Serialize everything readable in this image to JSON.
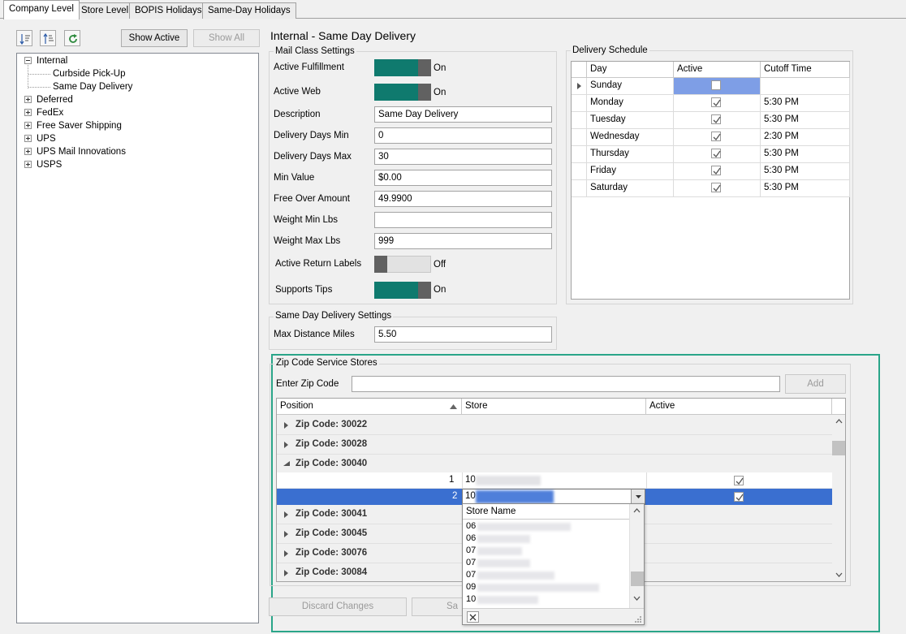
{
  "tabs": [
    "Company Level",
    "Store Level",
    "BOPIS Holidays",
    "Same-Day Holidays"
  ],
  "left_pane": {
    "show_active_label": "Show Active",
    "show_all_label": "Show All",
    "tree": {
      "root": "Internal",
      "children": [
        "Curbside Pick-Up",
        "Same Day Delivery"
      ],
      "siblings": [
        "Deferred",
        "FedEx",
        "Free Saver Shipping",
        "UPS",
        "UPS Mail Innovations",
        "USPS"
      ]
    }
  },
  "detail": {
    "title": "Internal - Same Day Delivery",
    "mail_class": {
      "group_title": "Mail Class Settings",
      "active_fulfillment": {
        "label": "Active Fulfillment",
        "state": "On"
      },
      "active_web": {
        "label": "Active Web",
        "state": "On"
      },
      "description": {
        "label": "Description",
        "value": "Same Day Delivery"
      },
      "delivery_days_min": {
        "label": "Delivery Days Min",
        "value": "0"
      },
      "delivery_days_max": {
        "label": "Delivery Days Max",
        "value": "30"
      },
      "min_value": {
        "label": "Min Value",
        "value": "$0.00"
      },
      "free_over_amount": {
        "label": "Free Over Amount",
        "value": "49.9900"
      },
      "weight_min": {
        "label": "Weight Min Lbs",
        "value": ""
      },
      "weight_max": {
        "label": "Weight Max Lbs",
        "value": "999"
      },
      "active_return_labels": {
        "label": "Active Return Labels",
        "state": "Off"
      },
      "supports_tips": {
        "label": "Supports Tips",
        "state": "On"
      }
    },
    "same_day": {
      "group_title": "Same Day Delivery Settings",
      "max_distance": {
        "label": "Max Distance Miles",
        "value": "5.50"
      }
    },
    "schedule": {
      "group_title": "Delivery Schedule",
      "columns": [
        "Day",
        "Active",
        "Cutoff Time"
      ],
      "rows": [
        {
          "day": "Sunday",
          "active": false,
          "cutoff": ""
        },
        {
          "day": "Monday",
          "active": true,
          "cutoff": "5:30 PM"
        },
        {
          "day": "Tuesday",
          "active": true,
          "cutoff": "5:30 PM"
        },
        {
          "day": "Wednesday",
          "active": true,
          "cutoff": "2:30 PM"
        },
        {
          "day": "Thursday",
          "active": true,
          "cutoff": "5:30 PM"
        },
        {
          "day": "Friday",
          "active": true,
          "cutoff": "5:30 PM"
        },
        {
          "day": "Saturday",
          "active": true,
          "cutoff": "5:30 PM"
        }
      ]
    },
    "zip": {
      "group_title": "Zip Code Service Stores",
      "enter_label": "Enter Zip Code",
      "input_value": "",
      "add_label": "Add",
      "columns": [
        "Position",
        "Store",
        "Active"
      ],
      "groups_before": [
        "Zip Code: 30022",
        "Zip Code: 30028",
        "Zip Code: 30040"
      ],
      "expanded_rows": [
        {
          "position": "1",
          "store": "10",
          "active": true
        },
        {
          "position": "2",
          "store": "10",
          "active": true
        }
      ],
      "groups_after": [
        "Zip Code: 30041",
        "Zip Code: 30045",
        "Zip Code: 30076",
        "Zip Code: 30084"
      ],
      "dropdown": {
        "header": "Store Name",
        "items": [
          "06",
          "06",
          "07",
          "07",
          "07",
          "09",
          "10"
        ]
      }
    },
    "footer": {
      "discard_label": "Discard Changes",
      "save_label": "Sa"
    }
  },
  "colors": {
    "toggle_on": "#0f7a6e",
    "selection": "#3a6fd0",
    "highlight_box": "#2aa589",
    "schedule_selected_cell": "#7e9ee6"
  }
}
